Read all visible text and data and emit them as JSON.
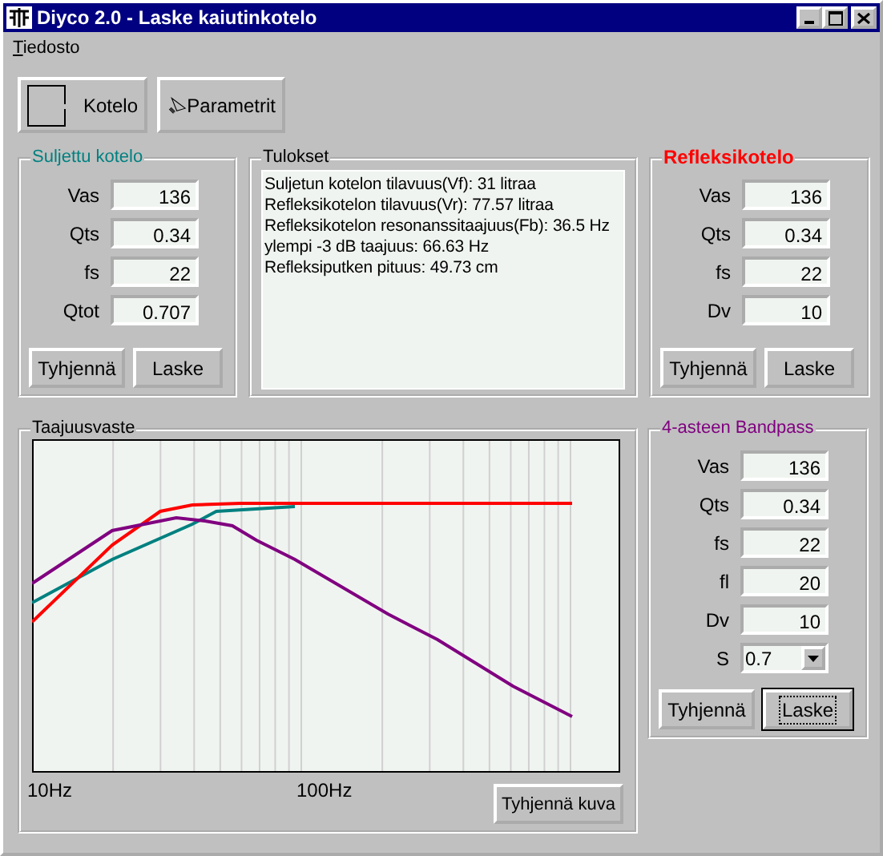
{
  "window": {
    "title": "Diyco 2.0 - Laske kaiutinkotelo"
  },
  "menu": [
    "Tiedosto"
  ],
  "toolbar": [
    {
      "label": "Kotelo",
      "kind": "box"
    },
    {
      "label": "Parametrit",
      "kind": "speaker"
    }
  ],
  "closed_box": {
    "title": "Suljettu kotelo",
    "color": "#008080",
    "fields": [
      {
        "label": "Vas",
        "value": "136"
      },
      {
        "label": "Qts",
        "value": "0.34"
      },
      {
        "label": "fs",
        "value": "22"
      },
      {
        "label": "Qtot",
        "value": "0.707"
      }
    ],
    "buttons": [
      {
        "label": "Tyhjennä",
        "focused": false
      },
      {
        "label": "Laske",
        "focused": false
      }
    ]
  },
  "results": {
    "title": "Tulokset",
    "lines": [
      "Suljetun kotelon tilavuus(Vf): 31 litraa",
      "Refleksikotelon tilavuus(Vr): 77.57 litraa",
      "Refleksikotelon resonanssitaajuus(Fb): 36.5 Hz",
      "ylempi -3 dB taajuus: 66.63 Hz",
      "Refleksiputken pituus: 49.73 cm"
    ]
  },
  "reflex_box": {
    "title": "Refleksikotelo",
    "color": "#ff0000",
    "fields": [
      {
        "label": "Vas",
        "value": "136"
      },
      {
        "label": "Qts",
        "value": "0.34"
      },
      {
        "label": "fs",
        "value": "22"
      },
      {
        "label": "Dv",
        "value": "10"
      }
    ],
    "buttons": [
      {
        "label": "Tyhjennä",
        "focused": false
      },
      {
        "label": "Laske",
        "focused": false
      }
    ]
  },
  "response": {
    "title": "Taajuusvaste",
    "x_labels": [
      "10Hz",
      "100Hz"
    ],
    "button": "Tyhjennä kuva"
  },
  "bandpass": {
    "title": "4-asteen Bandpass",
    "color": "#800080",
    "fields": [
      {
        "label": "Vas",
        "value": "136"
      },
      {
        "label": "Qts",
        "value": "0.34"
      },
      {
        "label": "fs",
        "value": "22"
      },
      {
        "label": "fl",
        "value": "20"
      },
      {
        "label": "Dv",
        "value": "10"
      },
      {
        "label": "S",
        "value": "0.7",
        "kind": "select"
      }
    ],
    "buttons": [
      {
        "label": "Tyhjennä",
        "focused": false
      },
      {
        "label": "Laske",
        "focused": true
      }
    ]
  }
}
